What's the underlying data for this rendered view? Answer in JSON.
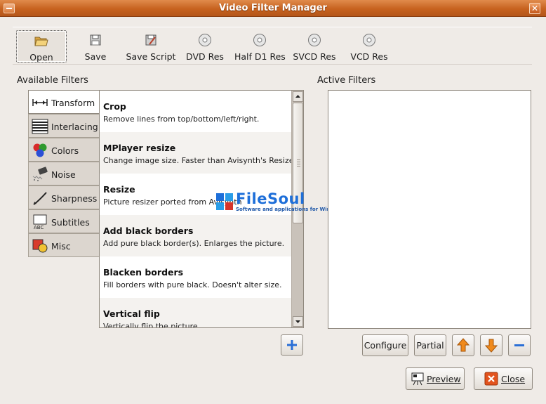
{
  "window": {
    "title": "Video Filter Manager",
    "close_glyph": "✕"
  },
  "toolbar": {
    "items": [
      {
        "label": "Open",
        "icon": "folder-open-icon"
      },
      {
        "label": "Save",
        "icon": "floppy-disk-icon"
      },
      {
        "label": "Save Script",
        "icon": "script-icon"
      },
      {
        "label": "DVD Res",
        "icon": "disc-icon"
      },
      {
        "label": "Half D1 Res",
        "icon": "disc-icon"
      },
      {
        "label": "SVCD Res",
        "icon": "disc-icon"
      },
      {
        "label": "VCD Res",
        "icon": "disc-icon"
      }
    ]
  },
  "available_filters": {
    "heading": "Available Filters",
    "categories": [
      {
        "label": "Transform",
        "icon": "transform-icon",
        "selected": true
      },
      {
        "label": "Interlacing",
        "icon": "interlacing-icon",
        "selected": false
      },
      {
        "label": "Colors",
        "icon": "colors-icon",
        "selected": false
      },
      {
        "label": "Noise",
        "icon": "noise-icon",
        "selected": false
      },
      {
        "label": "Sharpness",
        "icon": "sharpness-icon",
        "selected": false
      },
      {
        "label": "Subtitles",
        "icon": "subtitles-icon",
        "selected": false
      },
      {
        "label": "Misc",
        "icon": "misc-icon",
        "selected": false
      }
    ],
    "filters": [
      {
        "title": "Crop",
        "description": "Remove lines from top/bottom/left/right."
      },
      {
        "title": "MPlayer resize",
        "description": "Change image size. Faster than Avisynth's Resize."
      },
      {
        "title": "Resize",
        "description": "Picture resizer ported from Avisynth"
      },
      {
        "title": "Add black borders",
        "description": "Add pure black border(s). Enlarges the picture."
      },
      {
        "title": "Blacken borders",
        "description": "Fill borders with pure black. Doesn't alter size."
      },
      {
        "title": "Vertical flip",
        "description": "Vertically flip the picture."
      }
    ],
    "add_button_glyph": "+"
  },
  "active_filters": {
    "heading": "Active Filters",
    "items": []
  },
  "actions": {
    "configure": "Configure",
    "partial": "Partial",
    "move_up_glyph": "▲",
    "move_down_glyph": "▼",
    "remove_glyph": "−"
  },
  "dialog": {
    "preview": "Preview",
    "close": "Close"
  },
  "watermark": {
    "brand": "FileSoul",
    "tagline": "Software and applications for Windows"
  },
  "colors": {
    "titlebar": "#c7621f",
    "window_bg": "#efebe7",
    "arrow_orange": "#f08a1c",
    "add_blue": "#2a6fd6",
    "close_red": "#e2531d"
  }
}
